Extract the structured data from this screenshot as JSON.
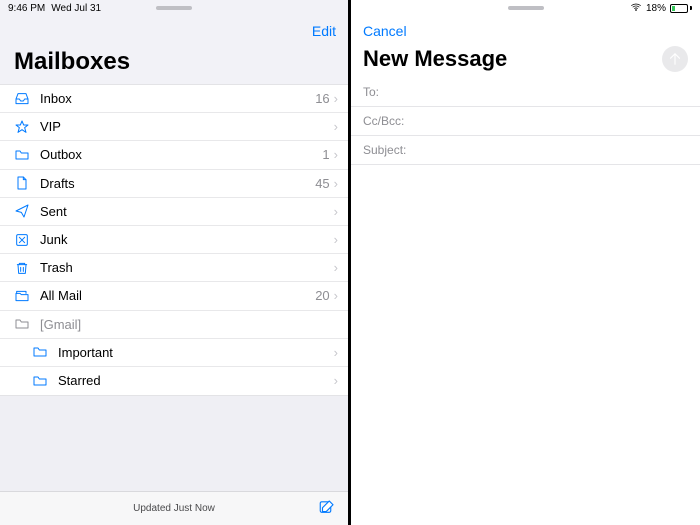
{
  "status": {
    "time": "9:46 PM",
    "date": "Wed Jul 31",
    "battery_pct": "18%"
  },
  "left": {
    "edit": "Edit",
    "title": "Mailboxes",
    "rows": [
      {
        "icon": "inbox",
        "label": "Inbox",
        "count": "16"
      },
      {
        "icon": "star",
        "label": "VIP",
        "count": ""
      },
      {
        "icon": "folder",
        "label": "Outbox",
        "count": "1"
      },
      {
        "icon": "doc",
        "label": "Drafts",
        "count": "45"
      },
      {
        "icon": "send",
        "label": "Sent",
        "count": ""
      },
      {
        "icon": "junk",
        "label": "Junk",
        "count": ""
      },
      {
        "icon": "trash",
        "label": "Trash",
        "count": ""
      },
      {
        "icon": "allmail",
        "label": "All Mail",
        "count": "20"
      },
      {
        "icon": "folder",
        "label": "[Gmail]",
        "count": "",
        "dim": true,
        "nochev": true
      },
      {
        "icon": "folder",
        "label": "Important",
        "count": "",
        "sub": true
      },
      {
        "icon": "folder",
        "label": "Starred",
        "count": "",
        "sub": true
      }
    ],
    "footer": "Updated Just Now"
  },
  "right": {
    "cancel": "Cancel",
    "title": "New Message",
    "fields": {
      "to": "To:",
      "cc": "Cc/Bcc:",
      "subject": "Subject:"
    }
  }
}
